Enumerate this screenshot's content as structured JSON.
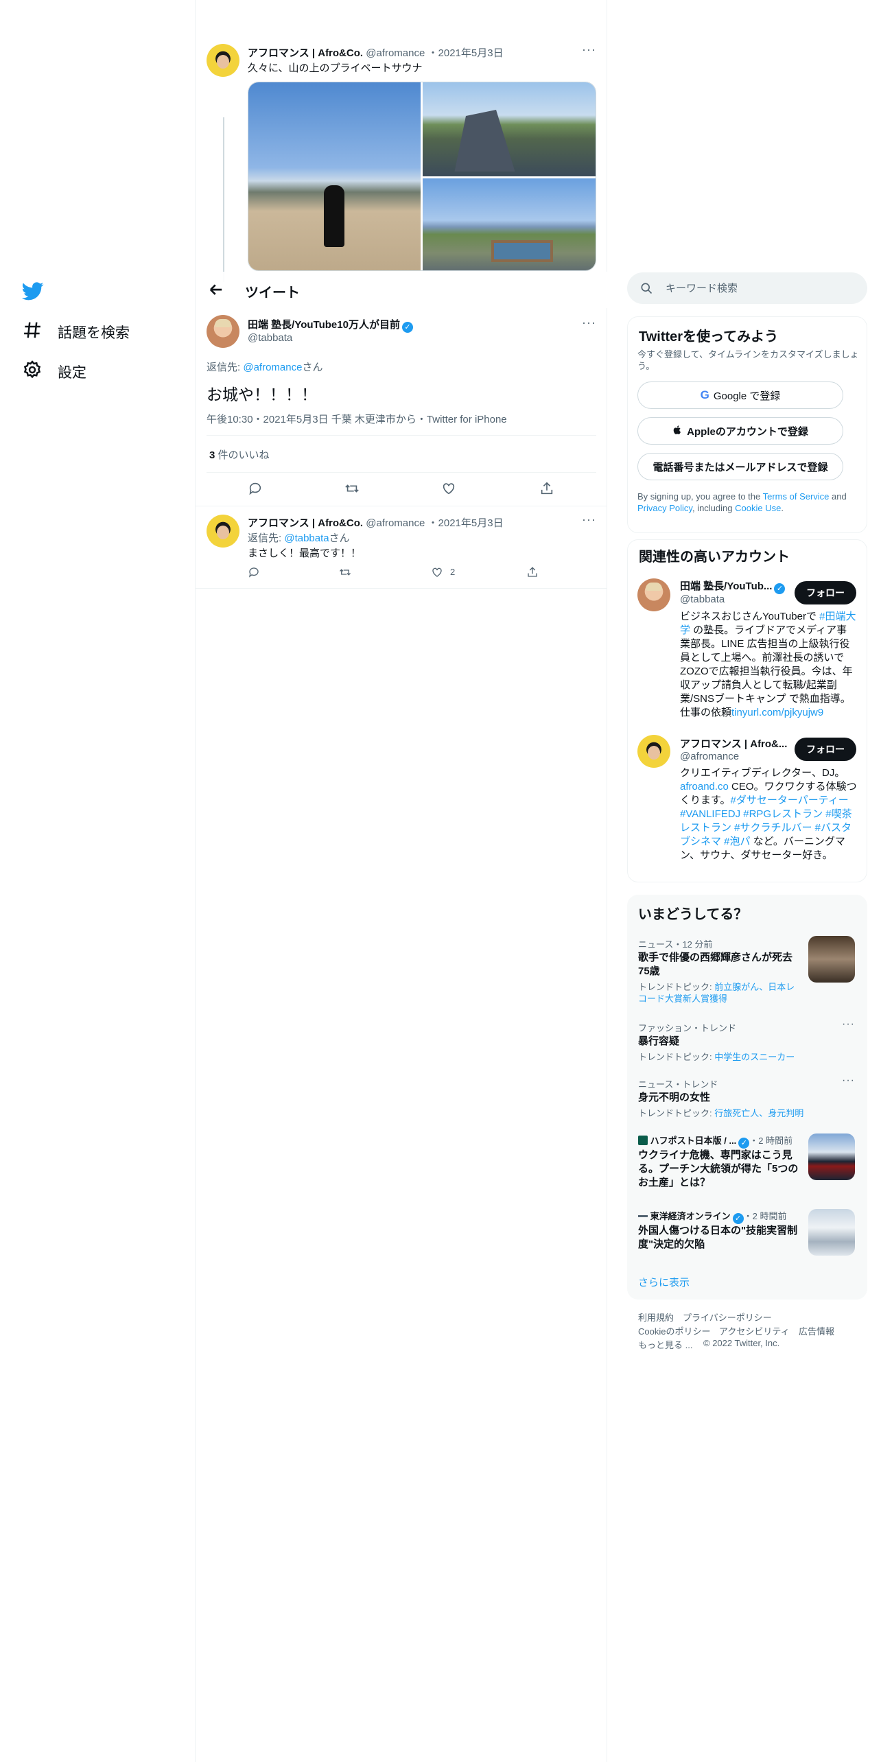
{
  "nav": {
    "items": [
      {
        "label": "話題を検索",
        "icon": "hashtag-icon"
      },
      {
        "label": "設定",
        "icon": "gear-icon"
      }
    ]
  },
  "parent_tweet": {
    "name": "アフロマンス | Afro&Co.",
    "handle": "@afromance",
    "date": "2021年5月3日",
    "text": "久々に、山の上のプライベートサウナ"
  },
  "header": {
    "title": "ツイート"
  },
  "main_tweet": {
    "name": "田端 塾長/YouTube10万人が目前",
    "handle": "@tabbata",
    "reply_prefix": "返信先: ",
    "reply_to": "@afromance",
    "reply_suffix": "さん",
    "text": "お城や！！！！",
    "meta": "午後10:30・2021年5月3日 千葉 木更津市から・Twitter for iPhone",
    "likes_count": "3",
    "likes_label": " 件のいいね"
  },
  "reply_tweet": {
    "name": "アフロマンス | Afro&Co.",
    "handle": "@afromance",
    "date": "2021年5月3日",
    "reply_prefix": "返信先: ",
    "reply_to": "@tabbata",
    "reply_suffix": "さん",
    "text": "まさしく！最高です！！",
    "like_count": "2"
  },
  "search": {
    "placeholder": "キーワード検索"
  },
  "signup": {
    "title": "Twitterを使ってみよう",
    "subtitle": "今すぐ登録して、タイムラインをカスタマイズしましょう。",
    "google": "Google で登録",
    "apple": "Appleのアカウントで登録",
    "phone": "電話番号またはメールアドレスで登録",
    "terms_1": "By signing up, you agree to the ",
    "terms_link1": "Terms of Service",
    "terms_2": " and ",
    "terms_link2": "Privacy Policy",
    "terms_3": ", including ",
    "terms_link3": "Cookie Use",
    "terms_4": "."
  },
  "related": {
    "title": "関連性の高いアカウント",
    "follow_label": "フォロー",
    "accounts": [
      {
        "name": "田端 塾長/YouTub...",
        "handle": "@tabbata",
        "bio_1": "ビジネスおじさんYouTuberで ",
        "bio_tag": "#田端大学",
        "bio_2": " の塾長。ライブドアでメディア事業部長。LINE 広告担当の上級執行役員として上場へ。前澤社長の誘いでZOZOで広報担当執行役員。今は、年収アップ請負人として転職/起業副業/SNSブートキャンプ で熱血指導。仕事の依頼",
        "bio_link": "tinyurl.com/pjkyujw9"
      },
      {
        "name": "アフロマンス | Afro&...",
        "handle": "@afromance",
        "bio_1": "クリエイティブディレクター、DJ。",
        "bio_link": "afroand.co",
        "bio_2": " CEO。ワクワクする体験つくります。",
        "bio_tags": "#ダサセーターパーティー #VANLIFEDJ #RPGレストラン #喫茶レストラン #サクラチルバー #バスタブシネマ #泡パ",
        "bio_3": " など。バーニングマン、サウナ、ダサセーター好き。"
      }
    ]
  },
  "trends": {
    "title": "いまどうしてる？",
    "items": [
      {
        "meta": "ニュース・12 分前",
        "name": "歌手で俳優の西郷輝彦さんが死去 75歳",
        "sub_label": "トレンドトピック: ",
        "sub_links": "前立腺がん、日本レコード大賞新人賞獲得"
      },
      {
        "meta": "ファッション・トレンド",
        "name": "暴行容疑",
        "sub_label": "トレンドトピック: ",
        "sub_links": "中学生のスニーカー"
      },
      {
        "meta": "ニュース・トレンド",
        "name": "身元不明の女性",
        "sub_label": "トレンドトピック: ",
        "sub_links": "行旅死亡人、身元判明"
      },
      {
        "meta_source": "ハフポスト日本版 / ...",
        "meta_time": "・2 時間前",
        "name": "ウクライナ危機、専門家はこう見る。プーチン大統領が得た「5つのお土産」とは？"
      },
      {
        "meta_source": "東洋経済オンライン",
        "meta_time": "・2 時間前",
        "name": "外国人傷つける日本の\"技能実習制度\"決定的欠陥"
      }
    ],
    "show_more": "さらに表示"
  },
  "footer": {
    "links": [
      "利用規約",
      "プライバシーポリシー",
      "Cookieのポリシー",
      "アクセシビリティ",
      "広告情報",
      "もっと見る ..."
    ],
    "copyright": "© 2022 Twitter, Inc."
  },
  "colors": {
    "accent": "#1d9bf0",
    "text": "#0f1419",
    "muted": "#536471",
    "border": "#eff3f4"
  }
}
